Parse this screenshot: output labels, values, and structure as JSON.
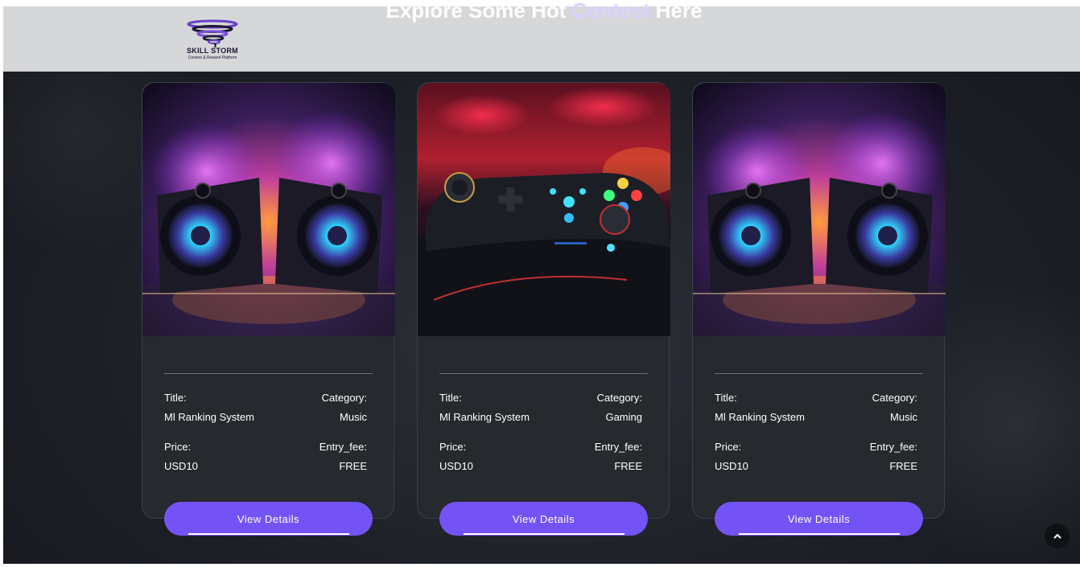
{
  "header": {
    "logo_name": "SKILL STORM",
    "logo_tagline": "Contest & Reward Platform"
  },
  "section": {
    "heading_start": "Explore Some Hot",
    "heading_accent": "Contest",
    "heading_end": "Here"
  },
  "labels": {
    "title": "Title:",
    "category": "Category:",
    "price": "Price:",
    "entry_fee": "Entry_fee:",
    "view_details": "View Details"
  },
  "cards": [
    {
      "image": "speakers-image",
      "title": "Ml Ranking System",
      "category": "Music",
      "price": "USD10",
      "entry_fee": "FREE"
    },
    {
      "image": "gamepad-image",
      "title": "Ml Ranking System",
      "category": "Gaming",
      "price": "USD10",
      "entry_fee": "FREE"
    },
    {
      "image": "speakers-image",
      "title": "Ml Ranking System",
      "category": "Music",
      "price": "USD10",
      "entry_fee": "FREE"
    }
  ],
  "scroll_top_icon": "chevron-up-icon",
  "colors": {
    "accent": "#7453f6",
    "heading_accent": "#d9d3ff",
    "card_bg": "#26292e",
    "header_bg": "#d6d7d9"
  }
}
